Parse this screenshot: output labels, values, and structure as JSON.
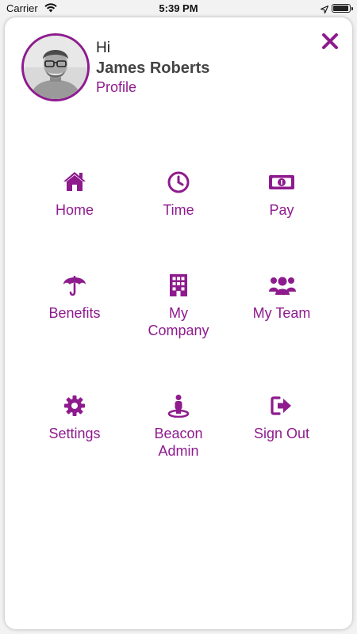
{
  "status_bar": {
    "carrier": "Carrier",
    "time": "5:39 PM"
  },
  "header": {
    "greeting": "Hi",
    "user_name": "James Roberts",
    "profile_link": "Profile"
  },
  "colors": {
    "accent": "#8e1b8e",
    "background": "#ffffff"
  },
  "menu": {
    "items": [
      {
        "label": "Home",
        "icon": "home-icon"
      },
      {
        "label": "Time",
        "icon": "clock-icon"
      },
      {
        "label": "Pay",
        "icon": "money-bill-icon"
      },
      {
        "label": "Benefits",
        "icon": "umbrella-icon"
      },
      {
        "label": "My\nCompany",
        "icon": "building-icon"
      },
      {
        "label": "My Team",
        "icon": "users-icon"
      },
      {
        "label": "Settings",
        "icon": "gear-icon"
      },
      {
        "label": "Beacon\nAdmin",
        "icon": "person-location-icon"
      },
      {
        "label": "Sign Out",
        "icon": "sign-out-icon"
      }
    ]
  }
}
